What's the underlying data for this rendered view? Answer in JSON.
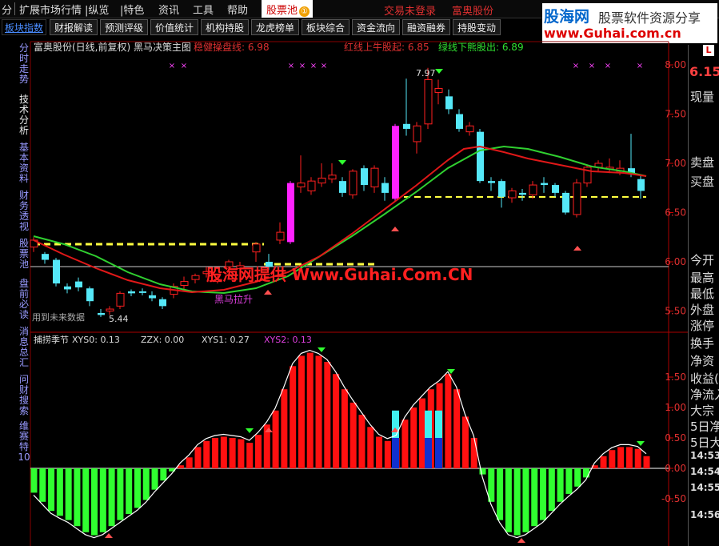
{
  "menubar": {
    "items": [
      "分",
      "扩展市场行情",
      "|纵览",
      "|特色",
      "资讯",
      "工具",
      "帮助"
    ],
    "active_tab": "股票池",
    "active_tab_badge": "①",
    "status_login": "交易未登录",
    "status_stock": "富奥股份"
  },
  "logo": {
    "brand": "股海网",
    "slogan": "股票软件资源分享",
    "url": "www.Guhai.com.cn"
  },
  "toolbar": {
    "buttons": [
      "板块指数",
      "财报解读",
      "预测评级",
      "价值统计",
      "机构持股",
      "龙虎榜单",
      "板块综合",
      "资金流向",
      "融资融券",
      "持股变动"
    ]
  },
  "side_tabs": [
    "分时走势",
    "技术分析",
    "基本资料",
    "财务透视",
    "股票池",
    "盘前必读",
    "消息总汇",
    "问财搜索",
    "维赛特10"
  ],
  "main_chart": {
    "title": "富奥股份(日线,前复权) 黑马决策主图",
    "ind1": "稳健操盘线: 6.98",
    "ind2": "红线上牛股起: 6.85",
    "ind3": "绿线下熊股出: 6.89",
    "high_label": "7.97",
    "low_label": "5.44",
    "annotation": "黑马拉升",
    "future_note": "用到未来数据",
    "watermark": "股海网提供 Www.Guhai.Com.CN",
    "y_ticks": [
      "8.00",
      "7.50",
      "7.00",
      "6.50",
      "6.00",
      "5.50"
    ]
  },
  "sub_chart": {
    "title": "捕捞季节",
    "xys0": "XYS0: 0.13",
    "zzx": "ZZX: 0.00",
    "xys1": "XYS1: 0.27",
    "xys2": "XYS2: 0.13",
    "y_ticks": [
      "1.50",
      "1.00",
      "0.50",
      "0.00",
      "-0.50"
    ]
  },
  "right_panel": {
    "L_badge": "L",
    "price": "6.15",
    "items": [
      "现量",
      "卖盘",
      "买盘",
      "今开",
      "最高",
      "最低",
      "外盘",
      "涨停",
      "换手",
      "净资",
      "收益(",
      "净流入",
      "大宗",
      "5日净",
      "5日大",
      "14:53",
      "14:54",
      "14:55",
      "14:56"
    ]
  },
  "colors": {
    "up": "#ff2020",
    "down": "#55e8f8",
    "ma_red": "#e01818",
    "ma_green": "#30d030",
    "dashed": "#ffff40",
    "magenta": "#ff22ff",
    "bar_red": "#ff1010",
    "bar_green": "#30ff30"
  }
}
